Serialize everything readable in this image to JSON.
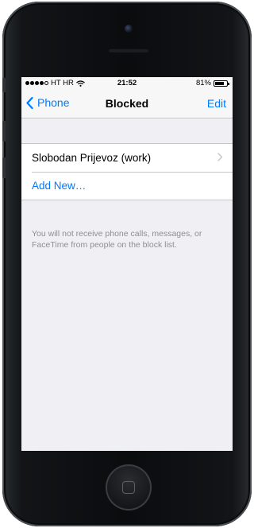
{
  "statusbar": {
    "carrier": "HT HR",
    "time": "21:52",
    "battery_text": "81%",
    "battery_level": 0.81,
    "signal_bars_filled": 4,
    "signal_bars_total": 5
  },
  "navbar": {
    "back_label": "Phone",
    "title": "Blocked",
    "edit_label": "Edit"
  },
  "list": {
    "contact_label": "Slobodan Prijevoz (work)",
    "add_new_label": "Add New…"
  },
  "footer_note": "You will not receive phone calls, messages, or FaceTime from people on the block list.",
  "colors": {
    "accent": "#007aff",
    "background": "#efeff4",
    "secondary_text": "#8e8e93"
  },
  "icons": [
    "signal-dots-icon",
    "wifi-icon",
    "battery-icon",
    "chevron-left-icon",
    "chevron-right-icon",
    "home-button-icon"
  ]
}
